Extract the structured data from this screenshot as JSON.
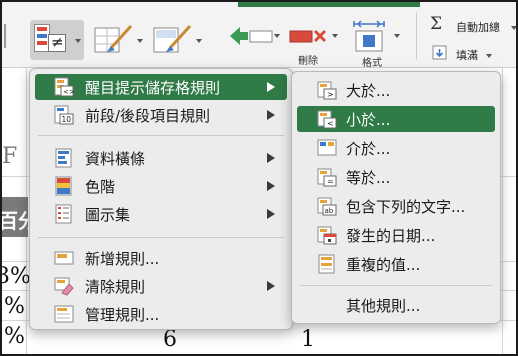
{
  "ribbon": {
    "autosum_label": "自動加總",
    "fill_label": "填滿",
    "delete_label": "刪除",
    "format_label": "格式",
    "cond_icon_symbol": "≠"
  },
  "sheet": {
    "column_letter": "F",
    "header_text": "百分",
    "cells": [
      "3%",
      "%",
      "%",
      "6",
      "1"
    ]
  },
  "main_menu": {
    "items": [
      {
        "label": "醒目提示儲存格規則",
        "has_submenu": true,
        "highlighted": true
      },
      {
        "label": "前段/後段項目規則",
        "has_submenu": true
      },
      {
        "label": "資料橫條",
        "has_submenu": true
      },
      {
        "label": "色階",
        "has_submenu": true
      },
      {
        "label": "圖示集",
        "has_submenu": true
      },
      {
        "label": "新增規則...",
        "has_submenu": false
      },
      {
        "label": "清除規則",
        "has_submenu": true
      },
      {
        "label": "管理規則...",
        "has_submenu": false
      }
    ],
    "top10_icon_text": "10"
  },
  "sub_menu": {
    "items": [
      {
        "label": "大於...",
        "icon_symbol": ">"
      },
      {
        "label": "小於...",
        "icon_symbol": "<",
        "highlighted": true
      },
      {
        "label": "介於..."
      },
      {
        "label": "等於...",
        "icon_symbol": "="
      },
      {
        "label": "包含下列的文字...",
        "icon_symbol": "ab"
      },
      {
        "label": "發生的日期..."
      },
      {
        "label": "重複的值..."
      },
      {
        "label": "其他規則..."
      }
    ]
  },
  "colors": {
    "highlight": "#2f7a46",
    "menu_bg": "#ececec"
  }
}
